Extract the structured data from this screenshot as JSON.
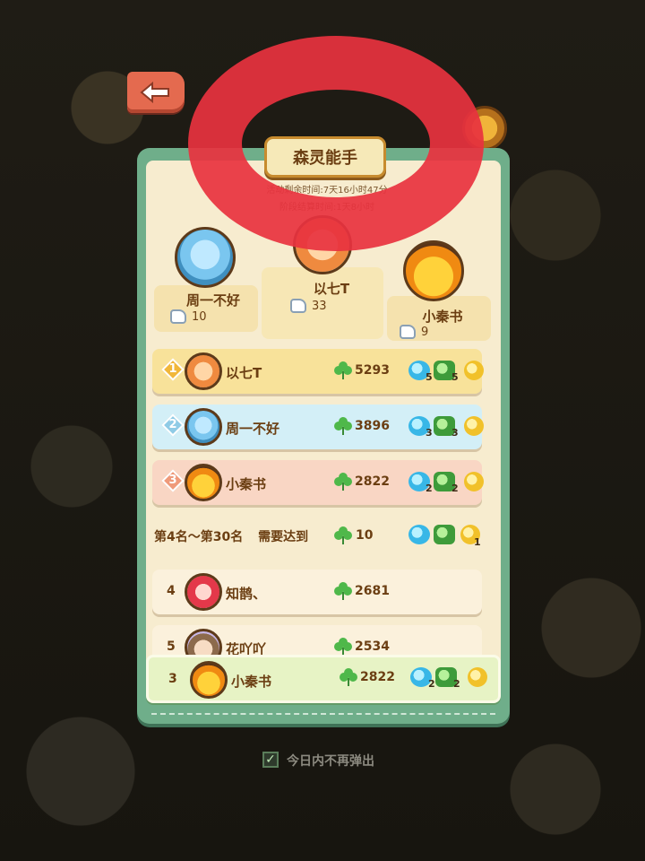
{
  "panel": {
    "title": "森灵能手",
    "timer_activity": "活动剩余时间:7天16小时47分",
    "timer_settlement": "阶段结算时间:1天8小时"
  },
  "podium": [
    {
      "name": "周一不好",
      "likes": "10"
    },
    {
      "name": "以七T",
      "likes": "33"
    },
    {
      "name": "小秦书",
      "likes": "9"
    }
  ],
  "rankings": [
    {
      "rank": "1",
      "name": "以七T",
      "score": "5293",
      "r_blue": "5",
      "r_green": "5"
    },
    {
      "rank": "2",
      "name": "周一不好",
      "score": "3896",
      "r_blue": "3",
      "r_green": "3"
    },
    {
      "rank": "3",
      "name": "小秦书",
      "score": "2822",
      "r_blue": "2",
      "r_green": "2"
    }
  ],
  "threshold": {
    "range_label": "第4名～第30名",
    "need_label": "需要达到",
    "score": "10",
    "r_gold": "1"
  },
  "others": [
    {
      "rank": "4",
      "name": "知鹊、",
      "score": "2681"
    },
    {
      "rank": "5",
      "name": "花吖吖",
      "score": "2534"
    }
  ],
  "me": {
    "rank": "3",
    "name": "小秦书",
    "score": "2822",
    "r_blue": "2",
    "r_green": "2"
  },
  "footer": {
    "dont_show_today": "今日内不再弹出",
    "checked": true
  },
  "colors": {
    "accent": "#6fae8a",
    "panel": "#f7eccf",
    "scribble": "#e8323f"
  }
}
